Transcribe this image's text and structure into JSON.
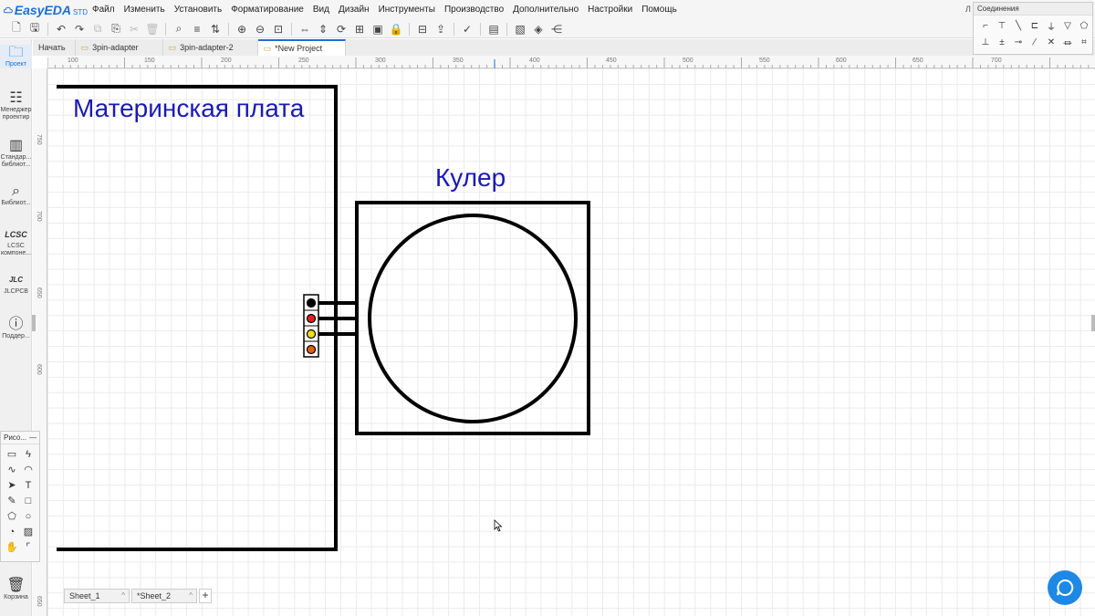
{
  "app": {
    "logo_text": "EasyEDA",
    "logo_sub": "STD",
    "user_abbr": "Л"
  },
  "menu": [
    "Файл",
    "Изменить",
    "Установить",
    "Форматирование",
    "Вид",
    "Дизайн",
    "Инструменты",
    "Производство",
    "Дополнительно",
    "Настройки",
    "Помощь"
  ],
  "sidebar": [
    {
      "label": "Проект",
      "icon": "folder-icon"
    },
    {
      "label": "Менеджер проектир",
      "icon": "design-manager-icon"
    },
    {
      "label": "Стандар... библиот...",
      "icon": "chip-icon"
    },
    {
      "label": "Библиот...",
      "icon": "library-search-icon"
    },
    {
      "label": "LCSC компоне...",
      "icon": "lcsc-icon"
    },
    {
      "label": "JLCPCB",
      "icon": "jlcpcb-icon"
    },
    {
      "label": "Поддер...",
      "icon": "support-icon"
    },
    {
      "label": "Корзина",
      "icon": "trash-icon"
    }
  ],
  "tabs": [
    {
      "label": "Начать",
      "folder": false,
      "active": false
    },
    {
      "label": "3pin-adapter",
      "folder": true,
      "active": false
    },
    {
      "label": "3pin-adapter-2",
      "folder": true,
      "active": false
    },
    {
      "label": "*New Project",
      "folder": true,
      "active": true
    }
  ],
  "ruler_top": [
    "100",
    "150",
    "200",
    "250",
    "300",
    "350",
    "400",
    "450",
    "500",
    "550",
    "600",
    "650",
    "700"
  ],
  "ruler_left": [
    "750",
    "700",
    "650",
    "600",
    "650"
  ],
  "wiring_panel": {
    "title": "Соединения"
  },
  "draw_panel": {
    "title": "Рисо...",
    "collapse": "—"
  },
  "canvas": {
    "motherboard_label": "Материнская плата",
    "cooler_label": "Кулер",
    "pin_colors": [
      "#000000",
      "#e02020",
      "#f0e010",
      "#e06010"
    ]
  },
  "sheets": [
    {
      "label": "Sheet_1",
      "caret": "^"
    },
    {
      "label": "*Sheet_2",
      "caret": "^"
    }
  ],
  "sheet_add": "+"
}
